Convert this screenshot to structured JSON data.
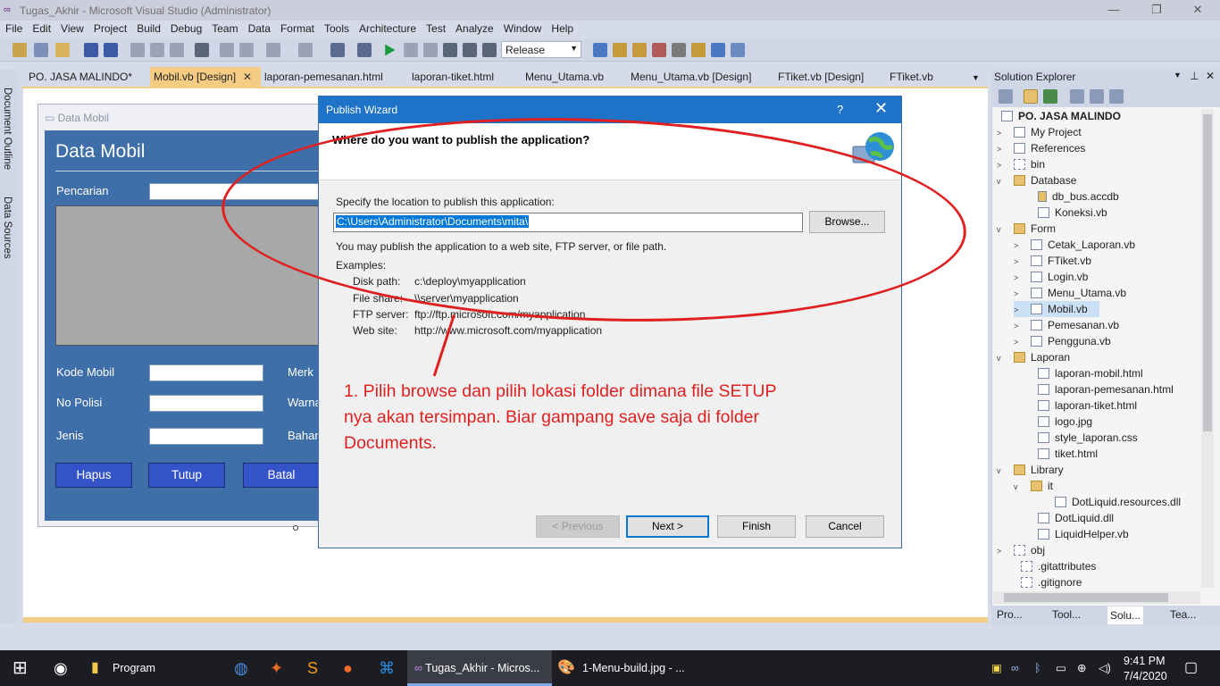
{
  "window": {
    "title": "Tugas_Akhir - Microsoft Visual Studio (Administrator)"
  },
  "menu": [
    "File",
    "Edit",
    "View",
    "Project",
    "Build",
    "Debug",
    "Team",
    "Data",
    "Format",
    "Tools",
    "Architecture",
    "Test",
    "Analyze",
    "Window",
    "Help"
  ],
  "toolbar": {
    "configuration": "Release"
  },
  "side_tabs": {
    "document_outline": "Document Outline",
    "data_sources": "Data Sources"
  },
  "tabs": [
    "PO. JASA MALINDO*",
    "Mobil.vb [Design]",
    "laporan-pemesanan.html",
    "laporan-tiket.html",
    "Menu_Utama.vb",
    "Menu_Utama.vb [Design]",
    "FTiket.vb [Design]",
    "FTiket.vb"
  ],
  "form": {
    "caption": "Data Mobil",
    "heading": "Data Mobil",
    "search_label": "Pencarian",
    "labels": {
      "kode": "Kode Mobil",
      "nopol": "No Polisi",
      "jenis": "Jenis",
      "merk": "Merk",
      "warna": "Warna",
      "bahan": "Bahan"
    },
    "buttons": {
      "hapus": "Hapus",
      "tutup": "Tutup",
      "batal": "Batal"
    }
  },
  "dialog": {
    "title": "Publish Wizard",
    "help": "?",
    "question": "Where do you want to publish the application?",
    "specify": "Specify the location to publish this application:",
    "path_value": "C:\\Users\\Administrator\\Documents\\mita\\",
    "browse": "Browse...",
    "may_publish": "You may publish the application to a web site, FTP server, or file path.",
    "examples_label": "Examples:",
    "examples": [
      {
        "k": "Disk path:",
        "v": "c:\\deploy\\myapplication"
      },
      {
        "k": "File share:",
        "v": "\\\\server\\myapplication"
      },
      {
        "k": "FTP server:",
        "v": "ftp://ftp.microsoft.com/myapplication"
      },
      {
        "k": "Web site:",
        "v": "http://www.microsoft.com/myapplication"
      }
    ],
    "buttons": {
      "previous": "< Previous",
      "next": "Next >",
      "finish": "Finish",
      "cancel": "Cancel"
    }
  },
  "annotation": "1. Pilih browse dan pilih lokasi folder dimana file SETUP nya akan tersimpan. Biar gampang save saja di folder Documents.",
  "solution_explorer": {
    "title": "Solution Explorer",
    "nodes": [
      {
        "label": "PO. JASA MALINDO"
      },
      {
        "label": "My Project"
      },
      {
        "label": "References"
      },
      {
        "label": "bin"
      },
      {
        "label": "Database"
      },
      {
        "label": "db_bus.accdb"
      },
      {
        "label": "Koneksi.vb"
      },
      {
        "label": "Form"
      },
      {
        "label": "Cetak_Laporan.vb"
      },
      {
        "label": "FTiket.vb"
      },
      {
        "label": "Login.vb"
      },
      {
        "label": "Menu_Utama.vb"
      },
      {
        "label": "Mobil.vb"
      },
      {
        "label": "Pemesanan.vb"
      },
      {
        "label": "Pengguna.vb"
      },
      {
        "label": "Laporan"
      },
      {
        "label": "laporan-mobil.html"
      },
      {
        "label": "laporan-pemesanan.html"
      },
      {
        "label": "laporan-tiket.html"
      },
      {
        "label": "logo.jpg"
      },
      {
        "label": "style_laporan.css"
      },
      {
        "label": "tiket.html"
      },
      {
        "label": "Library"
      },
      {
        "label": "it"
      },
      {
        "label": "DotLiquid.resources.dll"
      },
      {
        "label": "DotLiquid.dll"
      },
      {
        "label": "LiquidHelper.vb"
      },
      {
        "label": "obj"
      },
      {
        "label": ".gitattributes"
      },
      {
        "label": ".gitignore"
      }
    ],
    "bottom_tabs": [
      "Pro...",
      "Tool...",
      "Solu...",
      "Tea..."
    ]
  },
  "taskbar": {
    "items": [
      "Program",
      "Tugas_Akhir - Micros...",
      "1-Menu-build.jpg - ..."
    ],
    "time": "9:41 PM",
    "date": "7/4/2020"
  }
}
